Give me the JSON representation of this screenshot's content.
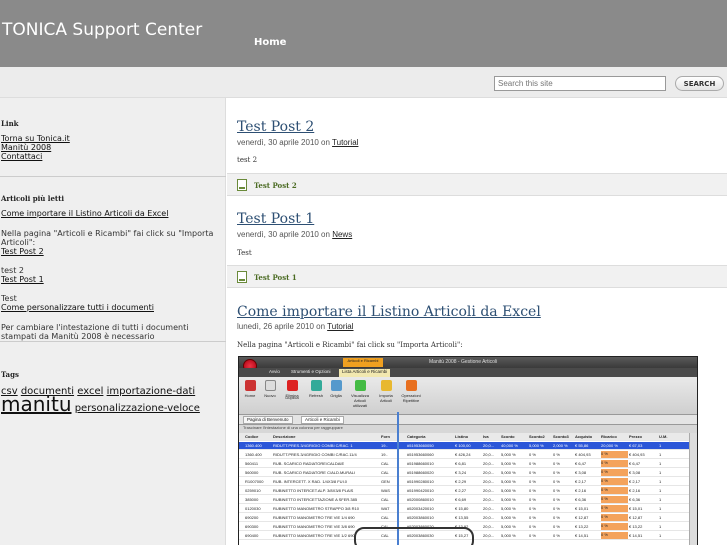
{
  "header": {
    "site_title": "TONICA Support Center",
    "nav": [
      {
        "label": "Home"
      }
    ]
  },
  "search": {
    "placeholder": "Search this site",
    "button_label": "SEARCH"
  },
  "sidebar": {
    "link_section": {
      "heading": "Link",
      "items": [
        "Torna su Tonica.it",
        "Manitù 2008",
        "Contattaci"
      ]
    },
    "popular_section": {
      "heading": "Articoli più letti",
      "entries": [
        {
          "link": "Come importare il Listino Articoli da Excel",
          "excerpt": "Nella pagina \"Articoli e Ricambi\" fai click su \"Importa Articoli\":"
        },
        {
          "link": "Test Post 2",
          "excerpt": "test 2"
        },
        {
          "link": "Test Post 1",
          "excerpt": "Test"
        },
        {
          "link": "Come personalizzare tutti i documenti",
          "excerpt": "Per cambiare l'intestazione di tutti i documenti stampati da Manitù 2008 è necessario"
        }
      ]
    },
    "tags_section": {
      "heading": "Tags",
      "tags": [
        "csv",
        "documenti",
        "excel",
        "importazione-dati",
        "manitu",
        "personalizzazione-veloce"
      ]
    }
  },
  "posts": [
    {
      "title": "Test Post 2",
      "date": "venerdì, 30 aprile 2010 on",
      "category": "Tutorial",
      "body": "test 2",
      "footer_link": "Test Post 2"
    },
    {
      "title": "Test Post 1",
      "date": "venerdì, 30 aprile 2010 on",
      "category": "News",
      "body": "Test",
      "footer_link": "Test Post 1"
    },
    {
      "title": "Come importare il Listino Articoli da Excel",
      "date": "lunedì, 26 aprile 2010 on",
      "category": "Tutorial",
      "body": "Nella pagina \"Articoli e Ricambi\" fai click su \"Importa Articoli\":"
    }
  ],
  "screenshot": {
    "context_tab": "Articoli e Ricambi",
    "window_title": "Manitù 2008 - Gestione Articoli",
    "ribbon_tabs": [
      "Avvio",
      "Strumenti e Opzioni",
      "Lista Articoli e Ricambi"
    ],
    "ribbon_buttons": [
      "Home",
      "Nuovo",
      "Elimina",
      "Duplica",
      "Refresh",
      "Griglia",
      "Visualizza Articoli utilizzati",
      "Importa Articoli",
      "Operazioni Ripetitive"
    ],
    "doc_tabs": [
      "Pagina di Benvenuto",
      "Articoli e Ricambi"
    ],
    "group_hint": "Trascinare l'intestazione di una colonna per raggruppare",
    "columns": [
      "Codice",
      "Descrizione",
      "Forn",
      "Categoria",
      "Listino",
      "Iva",
      "Sconto",
      "Sconto2",
      "Sconto3",
      "Acquisto",
      "Ricarico",
      "Prezzo",
      "U.M."
    ],
    "rows": [
      [
        "1360.400",
        "RIDUTT.PRES.3/4GRIGIO COMBI C/RAC. 1",
        "19..",
        "#51953660050",
        "€ 100,00",
        "20,0...",
        "40,000 %",
        "5,000 %",
        "2,000 %",
        "€ 55,86",
        "20,000 %",
        "€ 67,03",
        "1"
      ],
      [
        "1360.400",
        "RIDUTT.PRES.3/4GRIGIO COMBI C/RAC.11/4",
        "19..",
        "#51953660060",
        "€ 426,24",
        "20,0...",
        "5,000 %",
        "0 %",
        "0 %",
        "€ 404,93",
        "0 %",
        "€ 404,93",
        "1"
      ],
      [
        "560411",
        "RUB. SCARICO RADIATORE/CALDAIE",
        "CAL",
        "#51988660010",
        "€ 6,81",
        "20,0...",
        "5,000 %",
        "0 %",
        "0 %",
        "€ 6,47",
        "0 %",
        "€ 6,47",
        "1"
      ],
      [
        "560000",
        "RUB. SCARICO RADIATORE C/ALD.MURALI",
        "CAL",
        "#51988660020",
        "€ 3,24",
        "20,0...",
        "5,000 %",
        "0 %",
        "0 %",
        "€ 3,08",
        "0 %",
        "€ 3,08",
        "1"
      ],
      [
        "R1007000",
        "RUB. INTERCETT. X RAD. 1/4X3/8 FUI.0",
        "GEN",
        "#51990280010",
        "€ 2,29",
        "20,0...",
        "5,000 %",
        "0 %",
        "0 %",
        "€ 2,17",
        "0 %",
        "€ 2,17",
        "1"
      ],
      [
        "0259010",
        "RUBINETTO INTERCET.ALP. 3/8X3/8 PLAIS",
        "WAS",
        "#51990420010",
        "€ 2,27",
        "20,0...",
        "5,000 %",
        "0 %",
        "0 %",
        "€ 2,16",
        "0 %",
        "€ 2,16",
        "1"
      ],
      [
        "385000",
        "RUBINETTO INTERCETTAZIONE A SFER.385",
        "CAL",
        "#52000860010",
        "€ 6,69",
        "20,0...",
        "5,000 %",
        "0 %",
        "0 %",
        "€ 6,36",
        "0 %",
        "€ 6,36",
        "1"
      ],
      [
        "0120030",
        "RUBINETTO MANOMETRO STRAPPO 3/8 R10",
        "WAT",
        "#52003420010",
        "€ 15,80",
        "20,0...",
        "5,000 %",
        "0 %",
        "0 %",
        "€ 15,01",
        "0 %",
        "€ 15,01",
        "1"
      ],
      [
        "690200",
        "RUBINETTO MANOMETRO TRE VIE 1/4 690",
        "CAL",
        "#52003860010",
        "€ 13,55",
        "20,0...",
        "5,000 %",
        "0 %",
        "0 %",
        "€ 12,87",
        "0 %",
        "€ 12,87",
        "1"
      ],
      [
        "690300",
        "RUBINETTO MANOMETRO TRE VIE 3/8 690",
        "CAL",
        "#52003860020",
        "€ 13,92",
        "20,0...",
        "5,000 %",
        "0 %",
        "0 %",
        "€ 13,22",
        "0 %",
        "€ 13,22",
        "1"
      ],
      [
        "690400",
        "RUBINETTO MANOMETRO TRE VIE 1/2 690",
        "CAL",
        "#52003860030",
        "€ 15,27",
        "20,0...",
        "5,000 %",
        "0 %",
        "0 %",
        "€ 14,51",
        "0 %",
        "€ 14,51",
        "1"
      ]
    ]
  }
}
